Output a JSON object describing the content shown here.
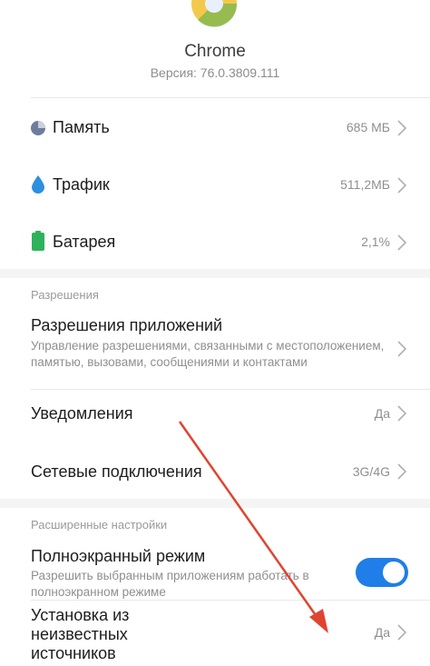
{
  "app": {
    "name": "Chrome",
    "version": "Версия: 76.0.3809.111"
  },
  "usage": [
    {
      "label": "Память",
      "value": "685 МБ",
      "icon": "pie-chart-icon"
    },
    {
      "label": "Трафик",
      "value": "511,2МБ",
      "icon": "water-drop-icon"
    },
    {
      "label": "Батарея",
      "value": "2,1%",
      "icon": "battery-icon"
    }
  ],
  "permissions": {
    "header": "Разрешения",
    "app_permissions": {
      "title": "Разрешения приложений",
      "subtitle": "Управление разрешениями, связанными с местоположением, памятью, вызовами, сообщениями и контактами"
    },
    "notifications": {
      "title": "Уведомления",
      "value": "Да"
    },
    "network": {
      "title": "Сетевые подключения",
      "value": "3G/4G"
    }
  },
  "advanced": {
    "header": "Расширенные настройки",
    "fullscreen": {
      "title": "Полноэкранный режим",
      "subtitle": "Разрешить выбранным приложениям работать в полноэкранном режиме",
      "enabled": true
    },
    "unknown_sources": {
      "title_lines": [
        "Установка из",
        "неизвестных",
        "источников"
      ],
      "value": "Да"
    }
  },
  "colors": {
    "accent": "#1f7ee8",
    "annotation_arrow": "#e0442f",
    "battery": "#2fb25b",
    "drop": "#2e8fe0",
    "pie": "#6e7d9c"
  }
}
